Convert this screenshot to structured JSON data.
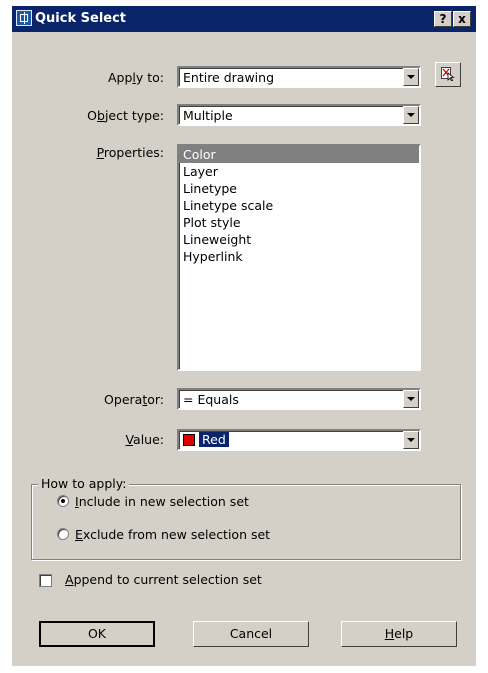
{
  "dialog": {
    "title": "Quick Select",
    "help_button": "?",
    "close_button": "x"
  },
  "form": {
    "apply_to": {
      "label_pre": "App",
      "label_u": "l",
      "label_post": "y to:",
      "value": "Entire drawing"
    },
    "object_type": {
      "label_pre": "O",
      "label_u": "b",
      "label_post": "ject type:",
      "value": "Multiple"
    },
    "properties": {
      "label_pre": "",
      "label_u": "P",
      "label_post": "roperties:",
      "items": [
        "Color",
        "Layer",
        "Linetype",
        "Linetype scale",
        "Plot style",
        "Lineweight",
        "Hyperlink"
      ],
      "selected_index": 0
    },
    "operator": {
      "label_pre": "Opera",
      "label_u": "t",
      "label_post": "or:",
      "value": "= Equals"
    },
    "value": {
      "label_pre": "",
      "label_u": "V",
      "label_post": "alue:",
      "value": "Red",
      "swatch_color": "#e00000"
    }
  },
  "how_to_apply": {
    "title": "How to apply:",
    "include": {
      "u": "I",
      "rest": "nclude in new selection set",
      "selected": true
    },
    "exclude": {
      "u": "E",
      "rest": "xclude from new selection set",
      "selected": false
    }
  },
  "append": {
    "u": "A",
    "rest": "ppend to current selection set",
    "checked": false
  },
  "buttons": {
    "ok": "OK",
    "cancel": "Cancel",
    "help_u": "H",
    "help_rest": "elp"
  },
  "colors": {
    "title_bar": "#0a246a",
    "face": "#d4d0c8",
    "selection": "#808080"
  }
}
